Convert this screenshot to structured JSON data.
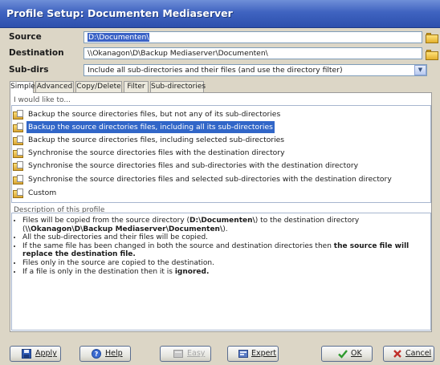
{
  "window": {
    "title": "Profile Setup: Documenten Mediaserver"
  },
  "form": {
    "source_label": "Source",
    "source_value": "D:\\Documenten\\",
    "destination_label": "Destination",
    "destination_value": "\\\\Okanagon\\D\\Backup Mediaserver\\Documenten\\",
    "subdirs_label": "Sub-dirs",
    "subdirs_value": "Include all sub-directories and their files (and use the directory filter)"
  },
  "tabs": [
    "Simple",
    "Advanced",
    "Copy/Delete",
    "Filter",
    "Sub-directories"
  ],
  "options": {
    "group_label": "I would like to...",
    "items": [
      "Backup the source directories files, but not any of its sub-directories",
      "Backup the source directories files, including all its sub-directories",
      "Backup the source directories files, including selected sub-directories",
      "Synchronise the source directories files with the destination directory",
      "Synchronise the source directories files and sub-directories with the destination directory",
      "Synchronise the source directories files and selected sub-directories with the destination directory",
      "Custom"
    ],
    "selected": "Backup the source directories files, including all its sub-directories"
  },
  "description": {
    "label": "Description of this profile",
    "b1_pre": "Files will be copied from the source directory (",
    "b1_src": "D:\\Documenten\\",
    "b1_mid": ") to the destination directory (",
    "b1_dst": "\\\\Okanagon\\D\\Backup Mediaserver\\Documenten\\",
    "b1_end": ").",
    "b2": "All the sub-directories and their files will be copied.",
    "b3_pre": "If the same file has been changed in both the source and destination directories then ",
    "b3_bold": "the source file will replace the destination file.",
    "b4": "Files only in the source are copied to the destination.",
    "b5_pre": "If a file is only in the destination then it is ",
    "b5_bold": "ignored."
  },
  "buttons": {
    "apply": "Apply",
    "help": "Help",
    "easy": "Easy",
    "expert": "Expert",
    "ok": "OK",
    "cancel": "Cancel"
  },
  "colors": {
    "title_bar": "#3f63c0",
    "selection": "#3166c8"
  }
}
